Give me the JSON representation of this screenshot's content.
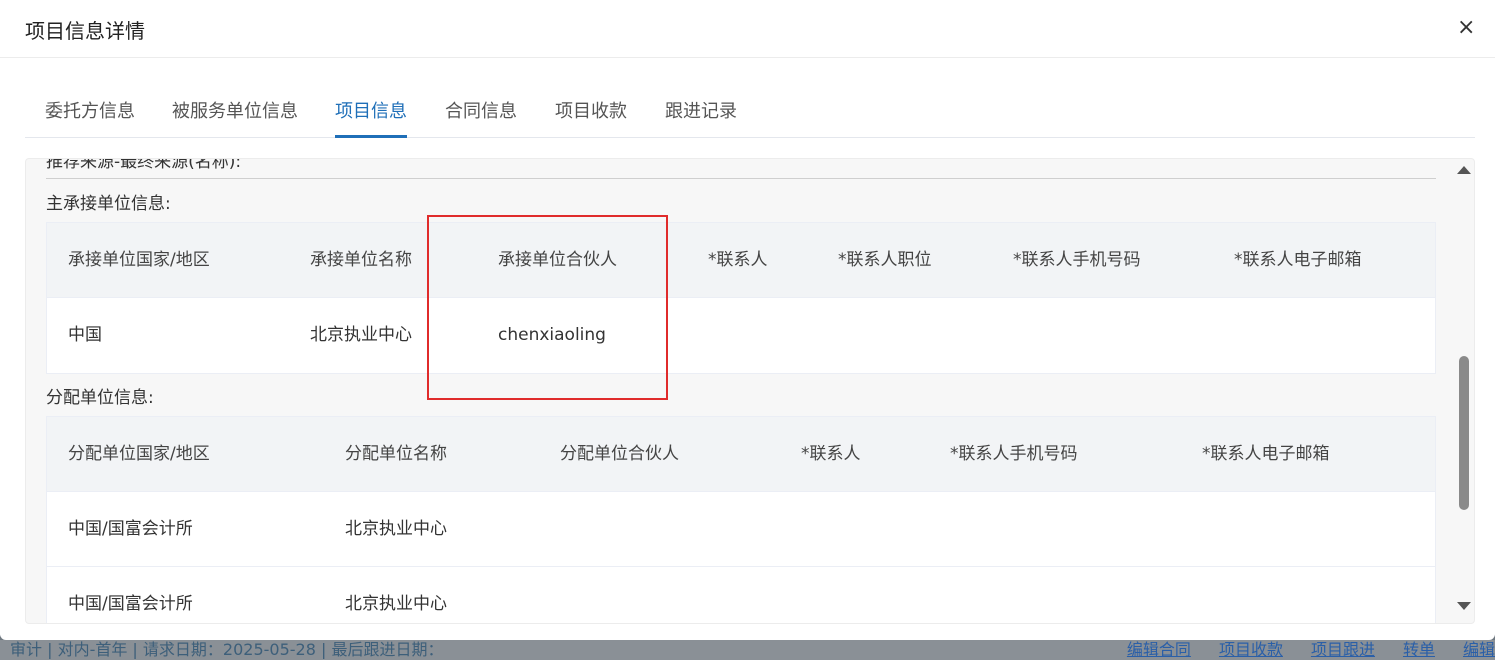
{
  "background": {
    "left_text": "审计 | 对内-首年 | 请求日期：2025-05-28 | 最后跟进日期：",
    "right_links": [
      "编辑合同",
      "项目收款",
      "项目跟进",
      "转单",
      "编辑"
    ]
  },
  "dialog": {
    "title": "项目信息详情",
    "close_label": "×"
  },
  "tabs": [
    {
      "label": "委托方信息",
      "active": false
    },
    {
      "label": "被服务单位信息",
      "active": false
    },
    {
      "label": "项目信息",
      "active": true
    },
    {
      "label": "合同信息",
      "active": false
    },
    {
      "label": "项目收款",
      "active": false
    },
    {
      "label": "跟进记录",
      "active": false
    }
  ],
  "content": {
    "cut_text": "推荐来源-最终来源(名称):",
    "main_unit": {
      "label": "主承接单位信息:",
      "headers": [
        "承接单位国家/地区",
        "承接单位名称",
        "承接单位合伙人",
        "*联系人",
        "*联系人职位",
        "*联系人手机号码",
        "*联系人电子邮箱"
      ],
      "rows": [
        [
          "中国",
          "北京执业中心",
          "chenxiaoling",
          "",
          "",
          "",
          ""
        ]
      ]
    },
    "alloc_unit": {
      "label": "分配单位信息:",
      "headers": [
        "分配单位国家/地区",
        "分配单位名称",
        "分配单位合伙人",
        "*联系人",
        "*联系人手机号码",
        "*联系人电子邮箱"
      ],
      "rows": [
        [
          "中国/国富会计所",
          "北京执业中心",
          "",
          "",
          "",
          ""
        ],
        [
          "中国/国富会计所",
          "北京执业中心",
          "",
          "",
          "",
          ""
        ]
      ]
    }
  },
  "colors": {
    "accent": "#1f6fb8",
    "highlight": "#e02b2b"
  }
}
